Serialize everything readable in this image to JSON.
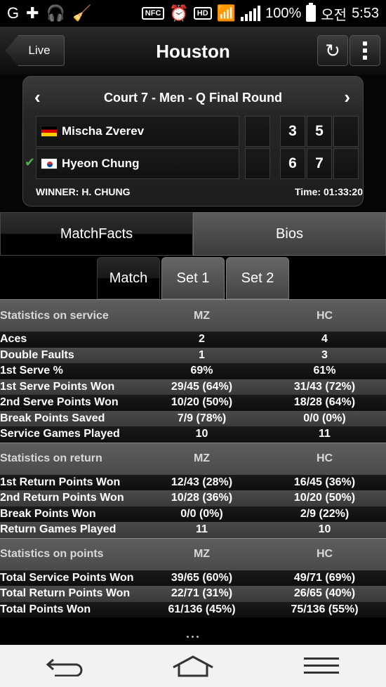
{
  "status_bar": {
    "battery": "100%",
    "ampm": "오전",
    "time": "5:53",
    "nfc": "NFC",
    "hd": "HD"
  },
  "header": {
    "back_label": "Live",
    "title": "Houston"
  },
  "match": {
    "court_round": "Court 7 - Men -  Q Final Round",
    "players": [
      {
        "name": "Mischa Zverev",
        "flag": "germany-flag",
        "sets": [
          "",
          "3",
          "5",
          ""
        ],
        "winner": false
      },
      {
        "name": "Hyeon Chung",
        "flag": "korea-flag",
        "sets": [
          "",
          "6",
          "7",
          ""
        ],
        "winner": true
      }
    ],
    "winner_text": "WINNER: H. CHUNG",
    "time_text": "Time: 01:33:20"
  },
  "tabs": {
    "matchfacts": "MatchFacts",
    "bios": "Bios"
  },
  "subtabs": {
    "match": "Match",
    "set1": "Set 1",
    "set2": "Set 2"
  },
  "stats": {
    "service": {
      "heading": "Statistics on service",
      "col1": "MZ",
      "col2": "HC",
      "rows": [
        {
          "label": "Aces",
          "mz": "2",
          "hc": "4"
        },
        {
          "label": "Double Faults",
          "mz": "1",
          "hc": "3"
        },
        {
          "label": "1st Serve %",
          "mz": "69%",
          "hc": "61%"
        },
        {
          "label": "1st Serve Points Won",
          "mz": "29/45 (64%)",
          "hc": "31/43 (72%)"
        },
        {
          "label": "2nd Serve Points Won",
          "mz": "10/20 (50%)",
          "hc": "18/28 (64%)"
        },
        {
          "label": "Break Points Saved",
          "mz": "7/9 (78%)",
          "hc": "0/0 (0%)"
        },
        {
          "label": "Service Games Played",
          "mz": "10",
          "hc": "11"
        }
      ]
    },
    "return": {
      "heading": "Statistics on return",
      "col1": "MZ",
      "col2": "HC",
      "rows": [
        {
          "label": "1st Return Points Won",
          "mz": "12/43 (28%)",
          "hc": "16/45 (36%)"
        },
        {
          "label": "2nd Return Points Won",
          "mz": "10/28 (36%)",
          "hc": "10/20 (50%)"
        },
        {
          "label": "Break Points Won",
          "mz": "0/0 (0%)",
          "hc": "2/9 (22%)"
        },
        {
          "label": "Return Games Played",
          "mz": "11",
          "hc": "10"
        }
      ]
    },
    "points": {
      "heading": "Statistics on points",
      "col1": "MZ",
      "col2": "HC",
      "rows": [
        {
          "label": "Total Service Points Won",
          "mz": "39/65 (60%)",
          "hc": "49/71 (69%)"
        },
        {
          "label": "Total Return Points Won",
          "mz": "22/71 (31%)",
          "hc": "26/65 (40%)"
        },
        {
          "label": "Total Points Won",
          "mz": "61/136 (45%)",
          "hc": "75/136 (55%)"
        }
      ]
    }
  },
  "colors": {
    "checkmark": "#4caf50",
    "section_header": "#4a4a4a"
  }
}
